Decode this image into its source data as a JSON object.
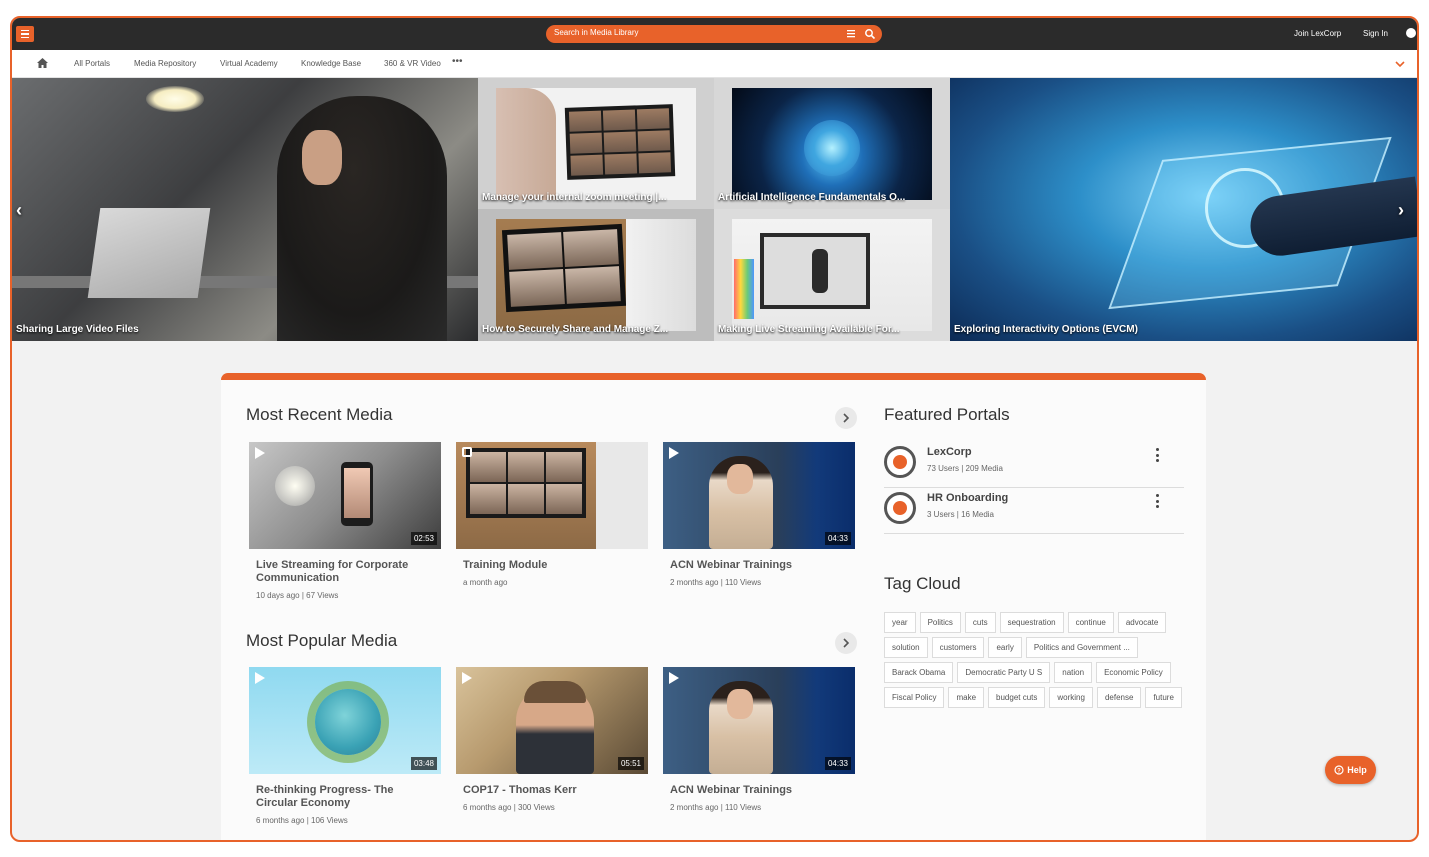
{
  "topbar": {
    "search_placeholder": "Search in Media Library",
    "join": "Join LexCorp",
    "signin": "Sign In"
  },
  "nav": {
    "items": [
      "All Portals",
      "Media Repository",
      "Virtual Academy",
      "Knowledge Base",
      "360 & VR Video"
    ],
    "more": "•••"
  },
  "hero": {
    "tiles": [
      {
        "caption": "Sharing Large Video Files"
      },
      {
        "caption": "Manage your internal zoom meeting |..."
      },
      {
        "caption": "Artificial Intelligence Fundamentals O..."
      },
      {
        "caption": "How to Securely Share and Manage Z..."
      },
      {
        "caption": "Making Live Streaming Available For..."
      },
      {
        "caption": "Exploring Interactivity Options (EVCM)"
      }
    ]
  },
  "recent": {
    "title": "Most Recent Media",
    "videos": [
      {
        "title": "Live Streaming for Corporate Communication",
        "meta": "10 days ago | 67 Views",
        "duration": "02:53"
      },
      {
        "title": "Training Module",
        "meta": "a month ago",
        "duration": ""
      },
      {
        "title": "ACN Webinar Trainings",
        "meta": "2 months ago | 110 Views",
        "duration": "04:33"
      }
    ]
  },
  "popular": {
    "title": "Most Popular Media",
    "videos": [
      {
        "title": "Re-thinking Progress- The Circular Economy",
        "meta": "6 months ago | 106 Views",
        "duration": "03:48"
      },
      {
        "title": "COP17 - Thomas Kerr",
        "meta": "6 months ago | 300 Views",
        "duration": "05:51"
      },
      {
        "title": "ACN Webinar Trainings",
        "meta": "2 months ago | 110 Views",
        "duration": "04:33"
      }
    ]
  },
  "featured": {
    "title": "Featured Portals",
    "portals": [
      {
        "name": "LexCorp",
        "meta": "73 Users | 209 Media"
      },
      {
        "name": "HR Onboarding",
        "meta": "3 Users | 16 Media"
      }
    ]
  },
  "tagcloud": {
    "title": "Tag Cloud",
    "tags": [
      "year",
      "Politics",
      "cuts",
      "sequestration",
      "continue",
      "advocate",
      "solution",
      "customers",
      "early",
      "Politics and Government ...",
      "Barack Obama",
      "Democratic Party U S",
      "nation",
      "Economic Policy",
      "Fiscal Policy",
      "make",
      "budget cuts",
      "working",
      "defense",
      "future"
    ]
  },
  "help": {
    "label": "Help"
  },
  "colors": {
    "accent": "#e8622a",
    "topbar": "#2b2b2b"
  }
}
